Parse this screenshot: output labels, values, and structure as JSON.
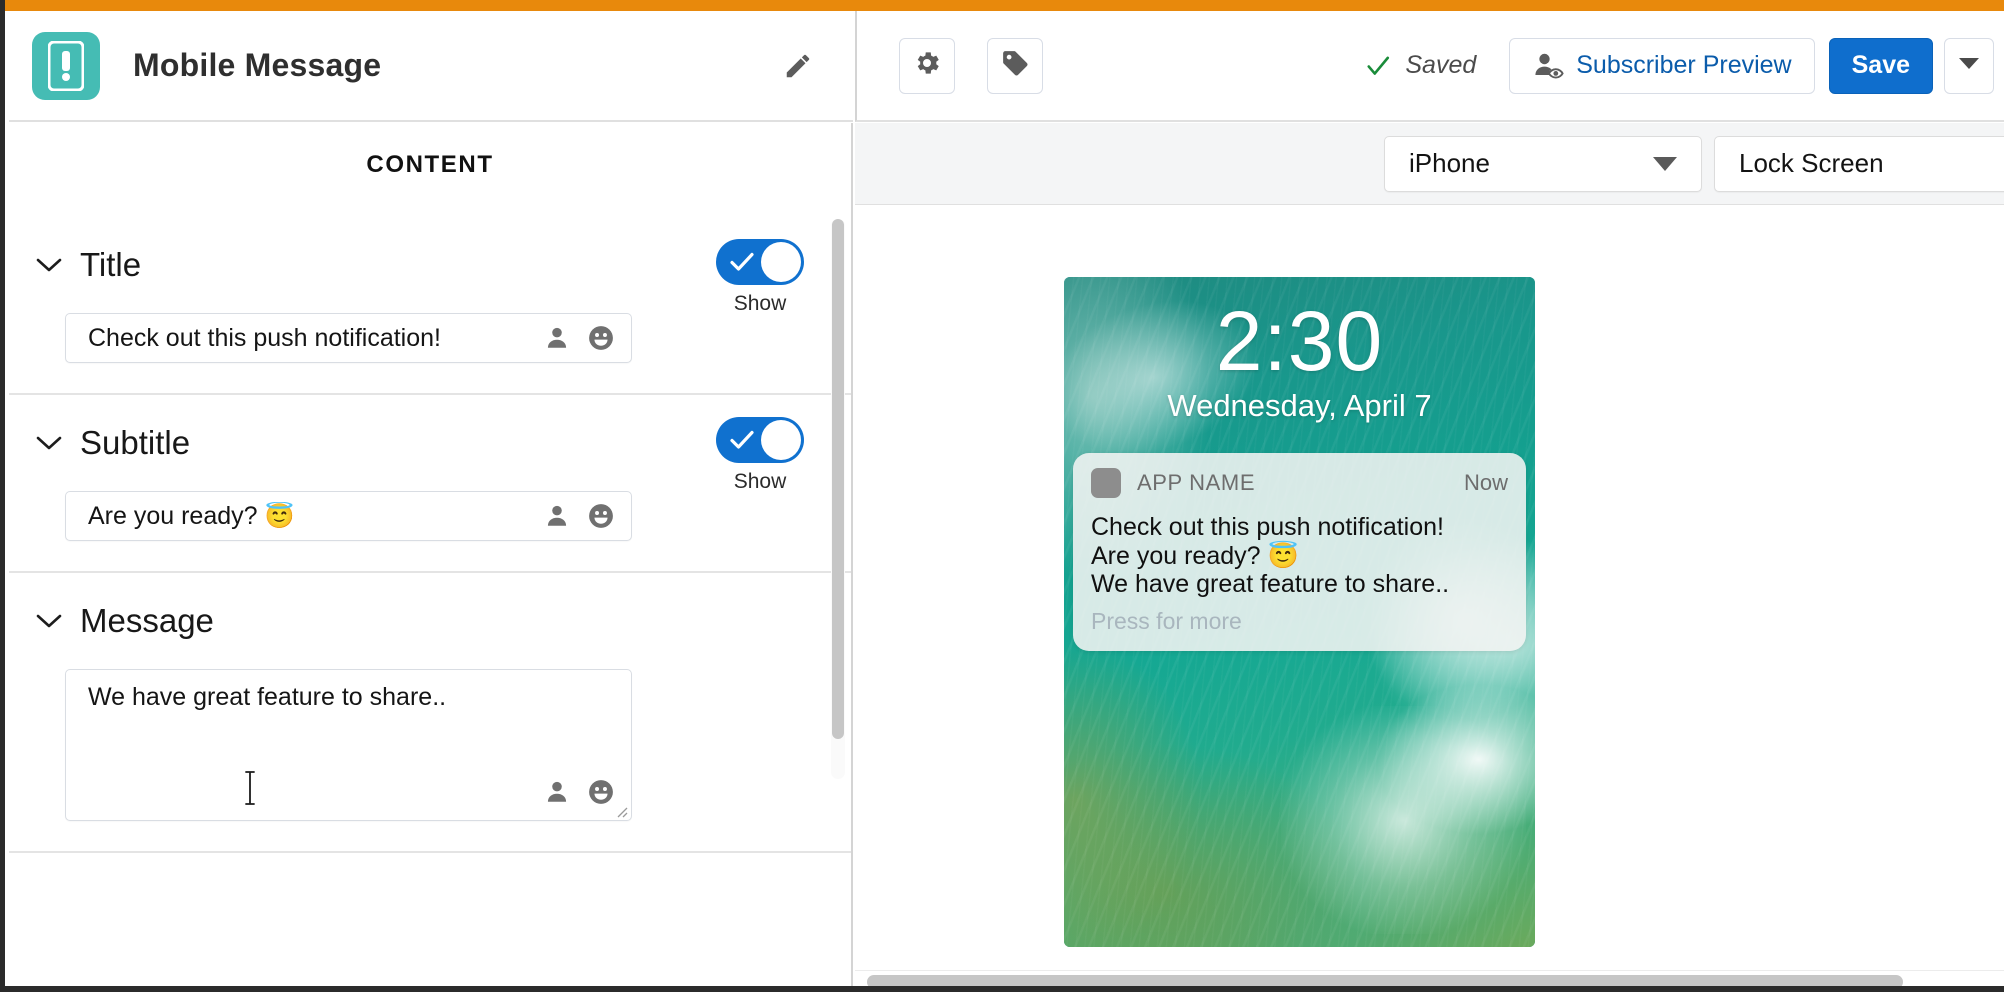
{
  "theme": {
    "accent_orange": "#e8890c",
    "brand_teal": "#45bcb4",
    "primary_blue": "#0f6ecd",
    "link_blue": "#0b5cab",
    "saved_green": "#1a8c3a"
  },
  "header": {
    "app_icon": "mobile-message-icon",
    "title": "Mobile Message",
    "edit_icon": "pencil-icon"
  },
  "toolbar": {
    "settings_icon": "gear-icon",
    "tag_icon": "tag-icon",
    "status_icon": "check-icon",
    "status_text": "Saved",
    "subscriber_preview_icon": "person-eye-icon",
    "subscriber_preview_label": "Subscriber Preview",
    "save_label": "Save",
    "save_menu_icon": "chevron-down-icon"
  },
  "left_panel": {
    "heading": "CONTENT",
    "sections": [
      {
        "id": "title",
        "chevron_icon": "chevron-down-icon",
        "label": "Title",
        "toggle": {
          "state": "on",
          "label": "Show",
          "icon": "check-icon"
        },
        "field": {
          "type": "input",
          "value": "Check out this push notification!",
          "placeholder": "",
          "icons": [
            "person-icon",
            "emoji-icon"
          ]
        }
      },
      {
        "id": "subtitle",
        "chevron_icon": "chevron-down-icon",
        "label": "Subtitle",
        "toggle": {
          "state": "on",
          "label": "Show",
          "icon": "check-icon"
        },
        "field": {
          "type": "input",
          "value": "Are you ready? ",
          "value_emoji": "😇",
          "placeholder": "",
          "icons": [
            "person-icon",
            "emoji-icon"
          ]
        }
      },
      {
        "id": "message",
        "chevron_icon": "chevron-down-icon",
        "label": "Message",
        "field": {
          "type": "textarea",
          "value": "We have great feature to share..",
          "placeholder": "",
          "icons": [
            "person-icon",
            "emoji-icon"
          ],
          "resize_handle": "resize-grip-icon"
        }
      }
    ],
    "scrollbar": "vertical-scrollbar"
  },
  "preview": {
    "device_select": {
      "value": "iPhone",
      "caret_icon": "caret-down-icon"
    },
    "screen_select": {
      "value": "Lock Screen",
      "caret_icon": "caret-down-icon"
    },
    "lock_screen": {
      "time": "2:30",
      "date": "Wednesday, April 7",
      "wallpaper": "ocean-wave-photo"
    },
    "notification": {
      "app_icon": "app-icon-placeholder",
      "app_name": "APP NAME",
      "timestamp": "Now",
      "lines": [
        "Check out this push notification!",
        "Are you ready? 😇",
        "We have great feature to share.."
      ],
      "footer": "Press for more"
    },
    "scrollbar": "horizontal-scrollbar"
  }
}
